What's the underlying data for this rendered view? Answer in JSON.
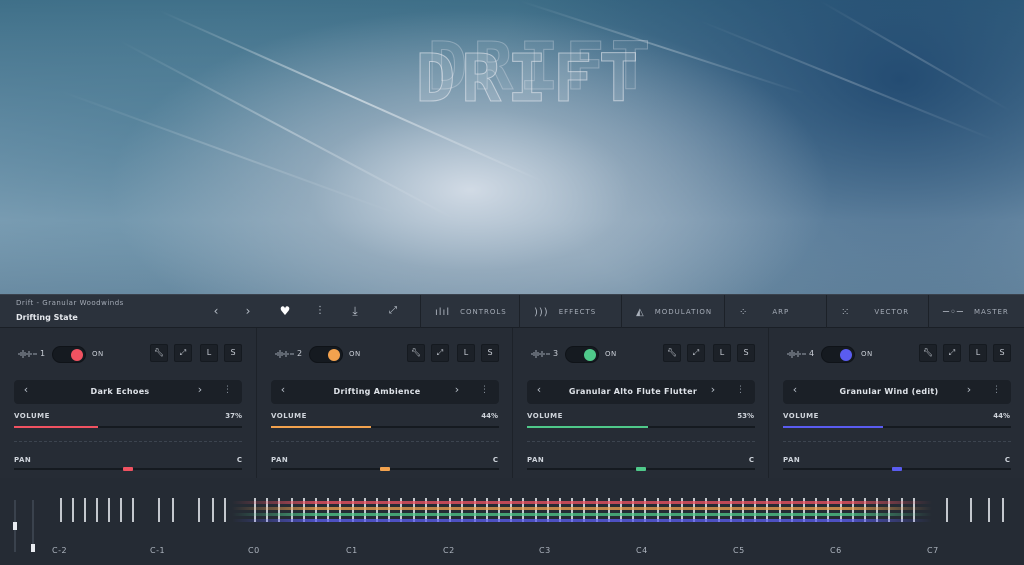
{
  "hero": {
    "title": "DRIFT"
  },
  "topbar": {
    "library": "Drift - Granular Woodwinds",
    "preset": "Drifting State",
    "tabs": [
      {
        "label": "CONTROLS",
        "icon": "waveform-icon"
      },
      {
        "label": "EFFECTS",
        "icon": "signal-icon"
      },
      {
        "label": "MODULATION",
        "icon": "modulation-icon"
      },
      {
        "label": "ARP",
        "icon": "arp-icon"
      },
      {
        "label": "VECTOR",
        "icon": "vector-icon"
      },
      {
        "label": "MASTER",
        "icon": "slider-icon"
      }
    ]
  },
  "channels": [
    {
      "num": "1",
      "on": "ON",
      "color": "#f05261",
      "preset": "Dark Echoes",
      "volume_label": "VOLUME",
      "volume": "37%",
      "volume_fraction": 0.37,
      "pan_label": "PAN",
      "pan": "C",
      "pan_fraction": 0.5
    },
    {
      "num": "2",
      "on": "ON",
      "color": "#f2a24e",
      "preset": "Drifting Ambience",
      "volume_label": "VOLUME",
      "volume": "44%",
      "volume_fraction": 0.44,
      "pan_label": "PAN",
      "pan": "C",
      "pan_fraction": 0.5
    },
    {
      "num": "3",
      "on": "ON",
      "color": "#4fc98a",
      "preset": "Granular Alto Flute Flutter",
      "volume_label": "VOLUME",
      "volume": "53%",
      "volume_fraction": 0.53,
      "pan_label": "PAN",
      "pan": "C",
      "pan_fraction": 0.5
    },
    {
      "num": "4",
      "on": "ON",
      "color": "#5a5cf0",
      "preset": "Granular Wind (edit)",
      "volume_label": "VOLUME",
      "volume": "44%",
      "volume_fraction": 0.44,
      "pan_label": "PAN",
      "pan": "C",
      "pan_fraction": 0.5
    }
  ],
  "channel_buttons": {
    "tool": "wrench-icon",
    "expand": "expand-icon",
    "L": "L",
    "S": "S"
  },
  "keyboard": {
    "octaves": [
      "C-2",
      "C-1",
      "C0",
      "C1",
      "C2",
      "C3",
      "C4",
      "C5",
      "C6",
      "C7"
    ]
  }
}
